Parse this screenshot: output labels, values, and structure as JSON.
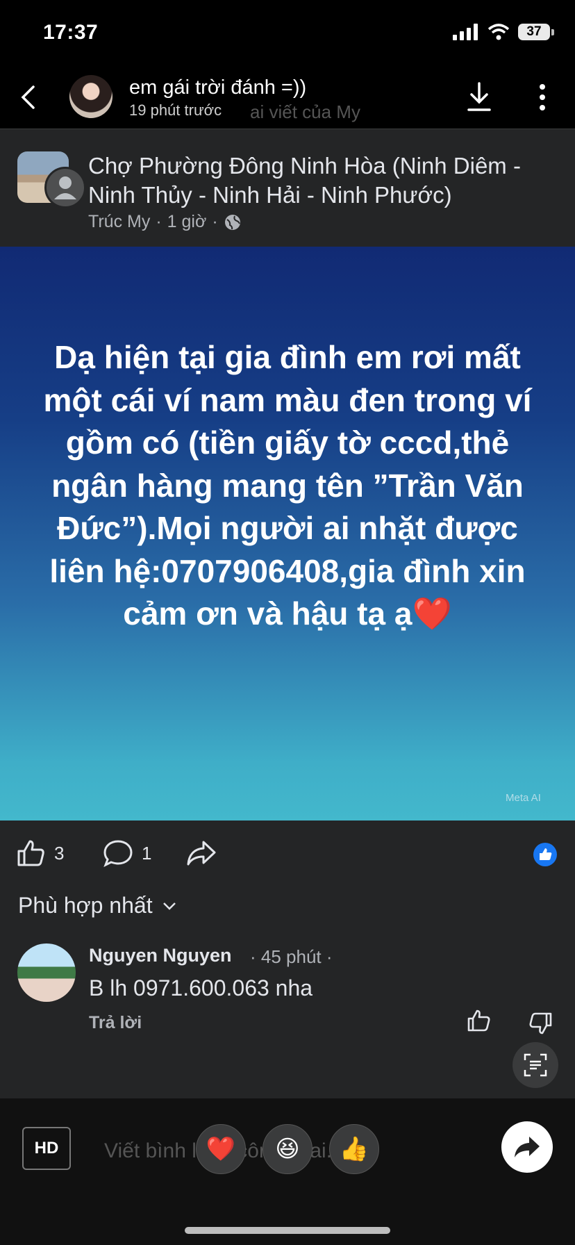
{
  "status": {
    "time": "17:37",
    "battery": "37"
  },
  "nav": {
    "title": "em gái trời đánh =))",
    "subtitle": "19 phút trước",
    "ghost_text": "ai viết của My"
  },
  "post": {
    "group_name": "Chợ Phường Đông Ninh Hòa (Ninh Diêm - Ninh Thủy - Ninh Hải - Ninh Phước)",
    "author": "Trúc My",
    "sep": "·",
    "time": "1 giờ",
    "image_text": "Dạ hiện tại gia đình em rơi mất một cái ví nam màu đen trong ví gồm có (tiền giấy tờ cccd,thẻ ngân hàng mang tên ”Trần Văn Đức”).Mọi người ai nhặt được liên hệ:0707906408,gia đình xin cảm ơn và hậu tạ ạ",
    "heart": "❤️",
    "meta_ai": "Meta AI"
  },
  "actions": {
    "likes": "3",
    "comments": "1"
  },
  "sort_label": "Phù hợp nhất",
  "comment": {
    "name": "Nguyen Nguyen",
    "time": "· 45 phút ·",
    "text": "B lh 0971.600.063 nha",
    "reply": "Trả lời"
  },
  "bottom": {
    "hd": "HD",
    "placeholder_ghost": "Viết bình luận công khai...",
    "reactions": [
      "❤️",
      "😆",
      "👍"
    ]
  }
}
